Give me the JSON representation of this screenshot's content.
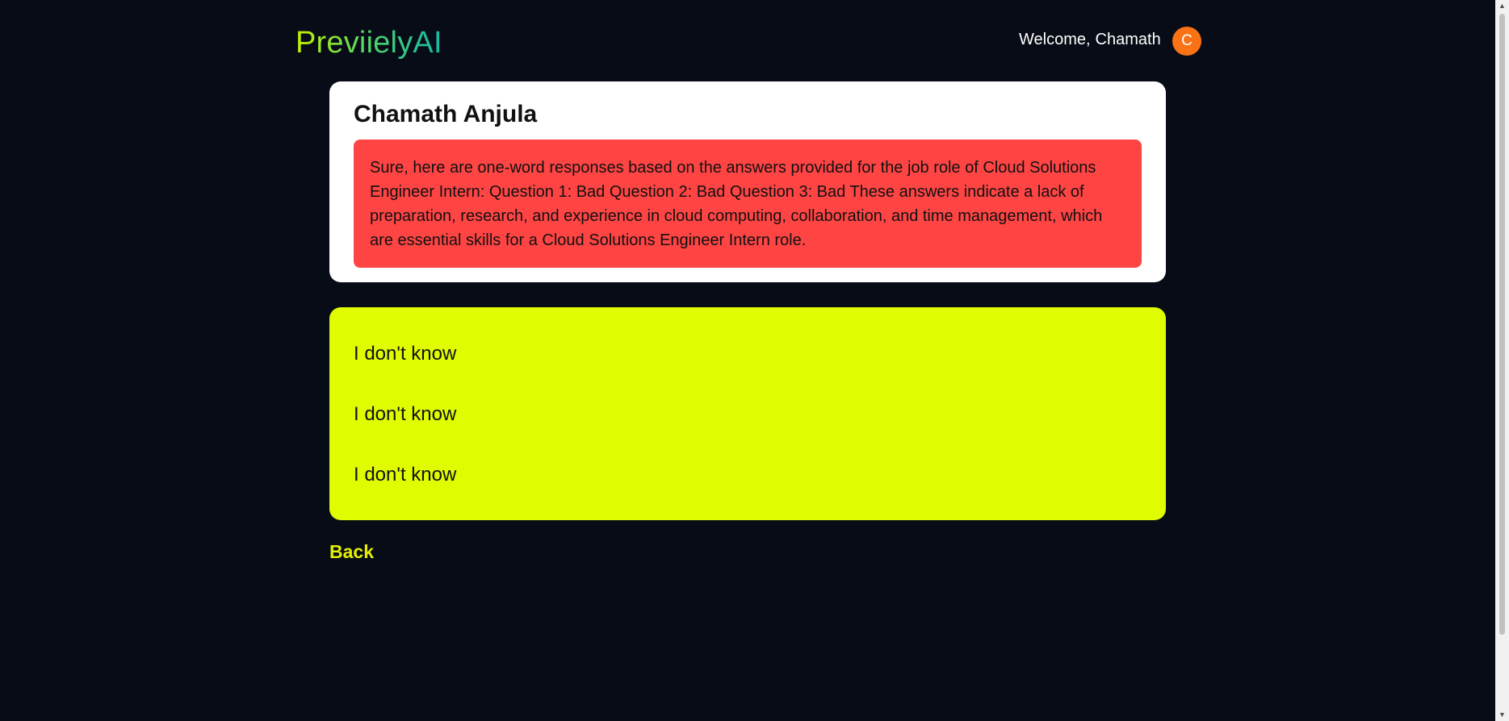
{
  "header": {
    "logo": "PreviielyAI",
    "welcome_prefix": "Welcome,",
    "welcome_name": "Chamath",
    "avatar_initial": "C"
  },
  "result": {
    "candidate_name": "Chamath Anjula",
    "feedback": "Sure, here are one-word responses based on the answers provided for the job role of Cloud Solutions Engineer Intern: Question 1: Bad Question 2: Bad Question 3: Bad These answers indicate a lack of preparation, research, and experience in cloud computing, collaboration, and time management, which are essential skills for a Cloud Solutions Engineer Intern role."
  },
  "answers": [
    "I don't know",
    "I don't know",
    "I don't know"
  ],
  "navigation": {
    "back_label": "Back"
  },
  "colors": {
    "background": "#080c16",
    "feedback_bad": "#ff4444",
    "answers_card": "#dffc00",
    "accent": "#e3f000",
    "avatar": "#f97316"
  }
}
